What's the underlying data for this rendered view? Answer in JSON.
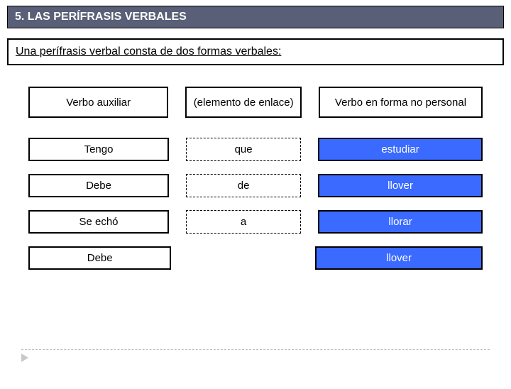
{
  "title": "5. LAS PERÍFRASIS VERBALES",
  "intro": "Una perífrasis verbal consta de dos formas verbales:",
  "headers": {
    "col1": "Verbo auxiliar",
    "col2": "(elemento de enlace)",
    "col3": "Verbo en forma no personal"
  },
  "rows": [
    {
      "aux": "Tengo",
      "link": "que",
      "verb": "estudiar",
      "hasLink": true
    },
    {
      "aux": "Debe",
      "link": "de",
      "verb": "llover",
      "hasLink": true
    },
    {
      "aux": "Se echó",
      "link": "a",
      "verb": "llorar",
      "hasLink": true
    },
    {
      "aux": "Debe",
      "link": "",
      "verb": "llover",
      "hasLink": false
    }
  ]
}
